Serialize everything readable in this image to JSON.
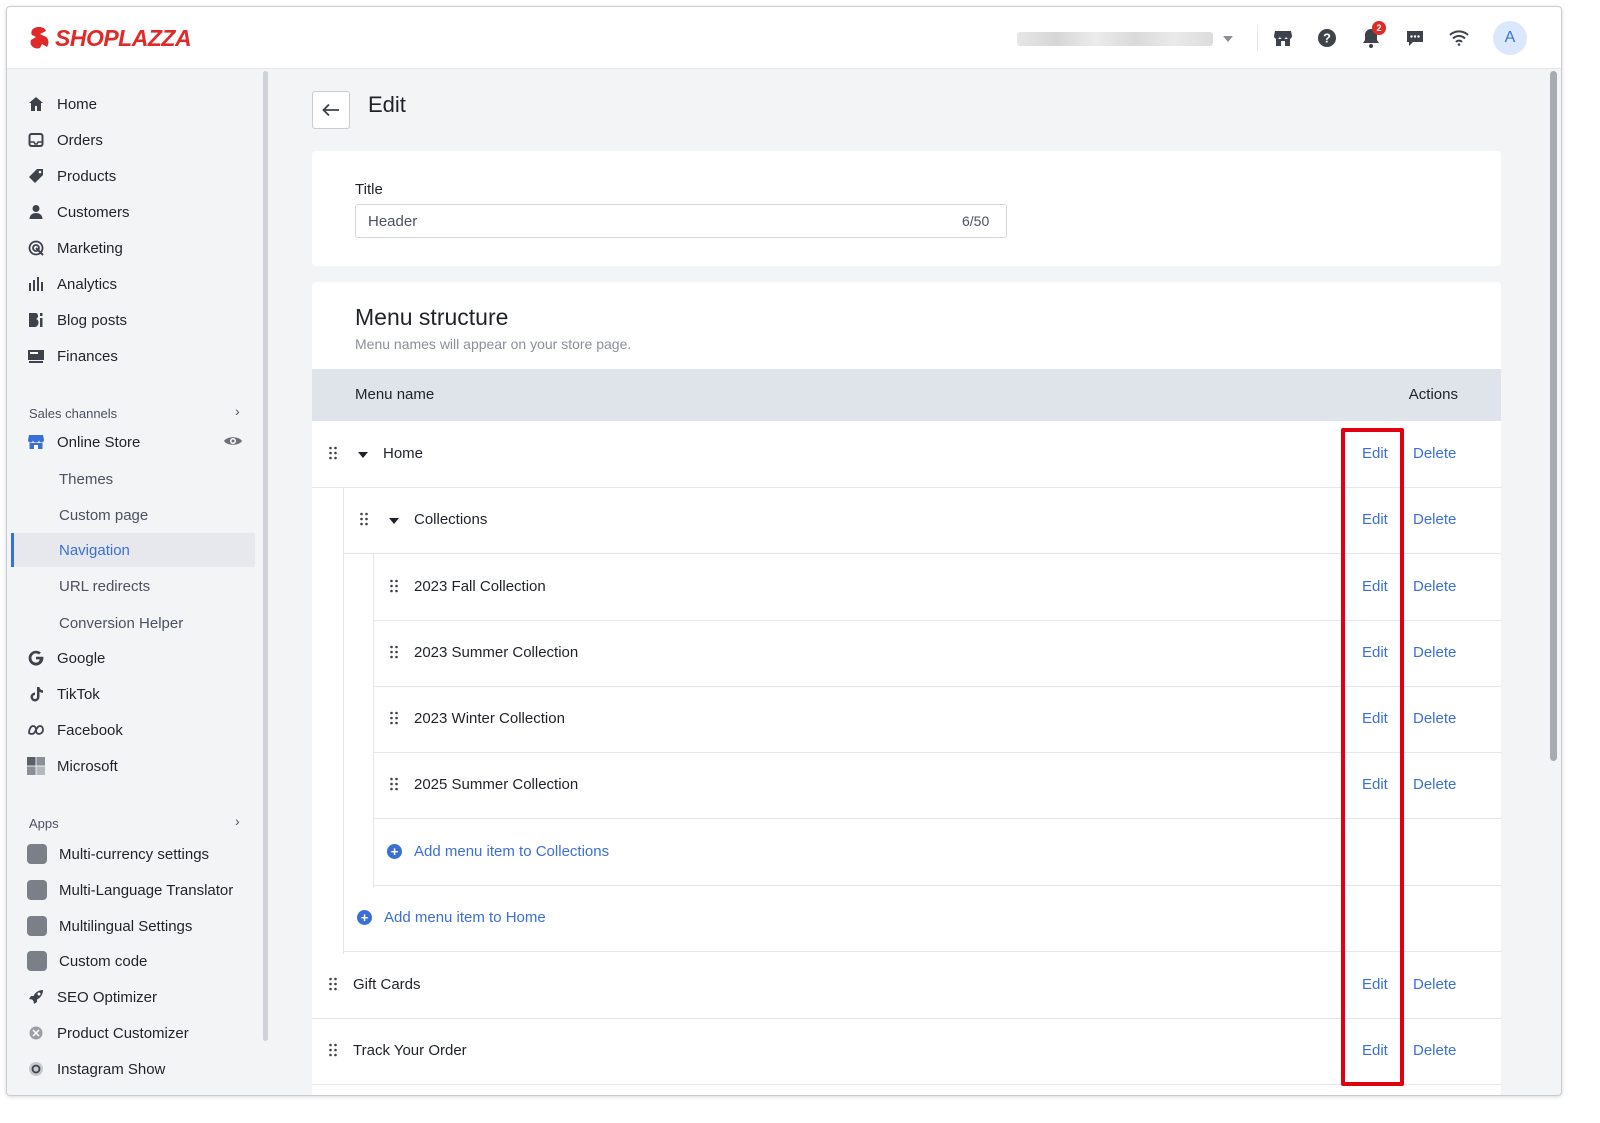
{
  "brand": {
    "name": "SHOPLAZZA",
    "color": "#e02a2a",
    "accent": "#3b6fd8"
  },
  "topbar": {
    "avatar_letter": "A",
    "notification_count": "2",
    "icons": [
      "store-icon",
      "help-icon",
      "bell-icon",
      "chat-icon",
      "wifi-icon"
    ]
  },
  "sidebar": {
    "main_items": [
      {
        "label": "Home",
        "icon": "home-icon"
      },
      {
        "label": "Orders",
        "icon": "orders-icon"
      },
      {
        "label": "Products",
        "icon": "tag-icon"
      },
      {
        "label": "Customers",
        "icon": "person-icon"
      },
      {
        "label": "Marketing",
        "icon": "marketing-icon"
      },
      {
        "label": "Analytics",
        "icon": "bar-chart-icon"
      },
      {
        "label": "Blog posts",
        "icon": "blog-icon"
      },
      {
        "label": "Finances",
        "icon": "finance-icon"
      }
    ],
    "sales_channels_label": "Sales channels",
    "online_store_label": "Online Store",
    "online_store_sub": [
      "Themes",
      "Custom page",
      "Navigation",
      "URL redirects",
      "Conversion Helper"
    ],
    "channels": [
      {
        "label": "Google",
        "icon": "google-icon"
      },
      {
        "label": "TikTok",
        "icon": "tiktok-icon"
      },
      {
        "label": "Facebook",
        "icon": "meta-icon"
      },
      {
        "label": "Microsoft",
        "icon": "microsoft-icon"
      }
    ],
    "apps_label": "Apps",
    "apps": [
      {
        "label": "Multi-currency settings"
      },
      {
        "label": "Multi-Language Translator"
      },
      {
        "label": "Multilingual Settings"
      },
      {
        "label": "Custom code"
      },
      {
        "label": "SEO Optimizer"
      },
      {
        "label": "Product Customizer"
      },
      {
        "label": "Instagram Show"
      }
    ]
  },
  "page": {
    "title": "Edit",
    "title_field": {
      "label": "Title",
      "value": "Header",
      "count": "6/50"
    },
    "menu_structure": {
      "heading": "Menu structure",
      "subheading": "Menu names will appear on your store page.",
      "col_name": "Menu name",
      "col_actions": "Actions",
      "edit_label": "Edit",
      "delete_label": "Delete",
      "rows": [
        {
          "name": "Home"
        },
        {
          "name": "Collections"
        },
        {
          "name": "2023 Fall Collection"
        },
        {
          "name": "2023 Summer Collection"
        },
        {
          "name": "2023 Winter Collection"
        },
        {
          "name": "2025 Summer Collection"
        },
        {
          "name": "Gift Cards"
        },
        {
          "name": "Track Your Order"
        }
      ],
      "add_collections": "Add menu item to Collections",
      "add_home": "Add menu item to Home"
    }
  }
}
